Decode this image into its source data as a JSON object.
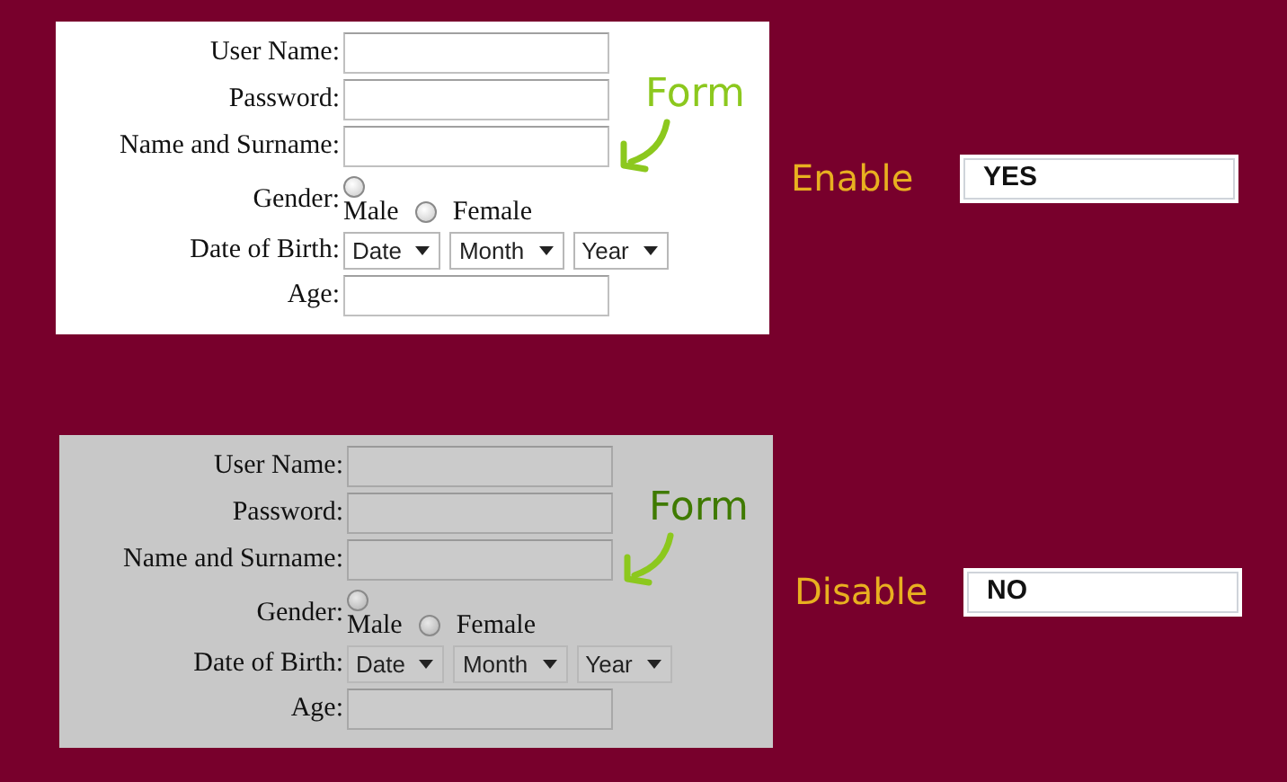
{
  "panels": [
    {
      "disabled": false,
      "annotation": "Form",
      "status_label": "Enable",
      "status_value": "YES",
      "fields": [
        {
          "kind": "text",
          "label": "User Name:"
        },
        {
          "kind": "text",
          "label": "Password:"
        },
        {
          "kind": "text",
          "label": "Name and Surname:"
        },
        {
          "kind": "radio",
          "label": "Gender:",
          "options": [
            {
              "label": "Male",
              "checked": false
            },
            {
              "label": "Female",
              "checked": false
            }
          ]
        },
        {
          "kind": "select",
          "label": "Date of Birth:",
          "options": [
            "Date",
            "Month",
            "Year"
          ]
        },
        {
          "kind": "text",
          "label": "Age:"
        }
      ]
    },
    {
      "disabled": true,
      "annotation": "Form",
      "status_label": "Disable",
      "status_value": "NO",
      "fields": [
        {
          "kind": "text",
          "label": "User Name:"
        },
        {
          "kind": "text",
          "label": "Password:"
        },
        {
          "kind": "text",
          "label": "Name and Surname:"
        },
        {
          "kind": "radio",
          "label": "Gender:",
          "options": [
            {
              "label": "Male",
              "checked": false
            },
            {
              "label": "Female",
              "checked": false
            }
          ]
        },
        {
          "kind": "select",
          "label": "Date of Birth:",
          "options": [
            "Date",
            "Month",
            "Year"
          ]
        },
        {
          "kind": "text",
          "label": "Age:"
        }
      ]
    }
  ]
}
